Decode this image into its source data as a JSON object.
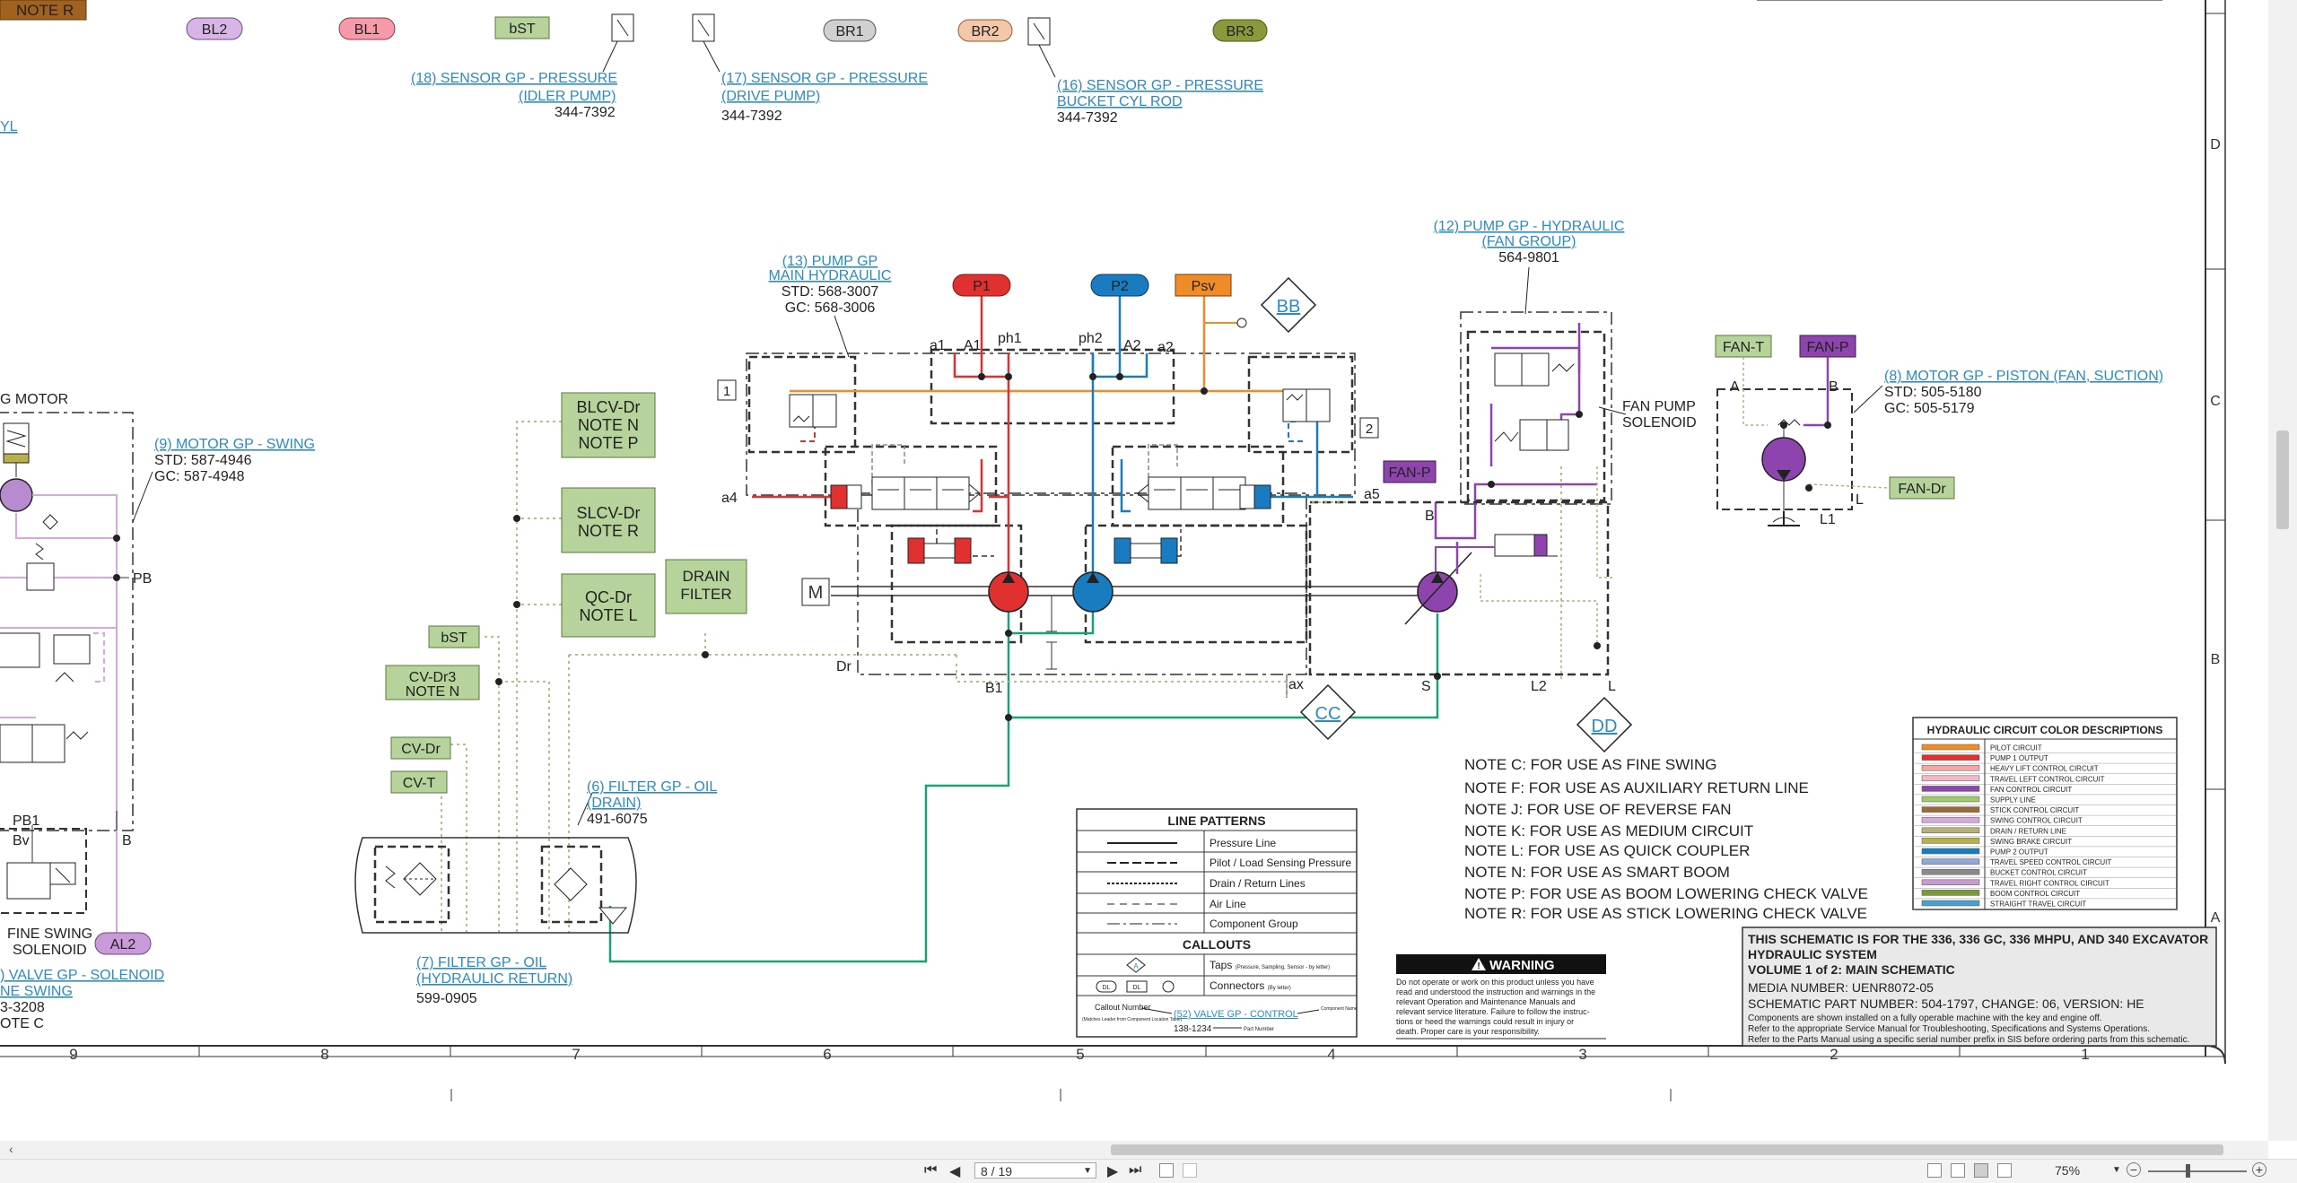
{
  "top_badges": {
    "bl2": "BL2",
    "bl1": "BL1",
    "bst": "bST",
    "br1": "BR1",
    "br2": "BR2",
    "br3": "BR3",
    "note_r": "NOTE R"
  },
  "callouts": {
    "c18_title": "(18) SENSOR GP - PRESSURE",
    "c18_sub": "(IDLER PUMP)",
    "c18_part": "344-7392",
    "c17_title": "(17) SENSOR GP - PRESSURE",
    "c17_sub": "(DRIVE PUMP)",
    "c17_part": "344-7392",
    "c16_title": "(16) SENSOR GP - PRESSURE",
    "c16_sub": "BUCKET CYL ROD",
    "c16_part": "344-7392",
    "yl": "YL",
    "c13_title": "(13) PUMP GP",
    "c13_sub": "MAIN HYDRAULIC",
    "c13_std": "STD: 568-3007",
    "c13_gc": "GC: 568-3006",
    "c12_title": "(12) PUMP GP - HYDRAULIC",
    "c12_sub": "(FAN GROUP)",
    "c12_part": "564-9801",
    "c8_title": "(8) MOTOR GP - PISTON (FAN, SUCTION)",
    "c8_std": "STD: 505-5180",
    "c8_gc": "GC: 505-5179",
    "c9_title": "(9) MOTOR GP - SWING",
    "c9_std": "STD: 587-4946",
    "c9_gc": "GC: 587-4948",
    "c6_title": "(6) FILTER GP - OIL",
    "c6_sub": "(DRAIN)",
    "c6_part": "491-6075",
    "c7_title": "(7) FILTER GP - OIL",
    "c7_sub": "(HYDRAULIC RETURN)",
    "c7_part": "599-0905",
    "cvalve_title": ") VALVE GP - SOLENOID",
    "cvalve_sub": "NE SWING",
    "cvalve_part": "3-3208",
    "cvalve_note": "OTE C",
    "swing_motor": "G MOTOR",
    "fan_pump_sol_1": "FAN PUMP",
    "fan_pump_sol_2": "SOLENOID",
    "fine_swing_1": "FINE SWING",
    "fine_swing_2": "SOLENOID"
  },
  "labels": {
    "p1": "P1",
    "p2": "P2",
    "psv": "Psv",
    "bb": "BB",
    "cc": "CC",
    "dd": "DD",
    "fan_t": "FAN-T",
    "fan_p": "FAN-P",
    "fan_p2": "FAN-P",
    "fan_dr": "FAN-Dr",
    "al2": "AL2",
    "a1": "A1",
    "a2": "A2",
    "a1l": "a1",
    "a2l": "a2",
    "ph1": "ph1",
    "ph2": "ph2",
    "a4": "a4",
    "a5": "a5",
    "dr": "Dr",
    "b1": "B1",
    "ax": "ax",
    "s": "S",
    "l2": "L2",
    "l": "L",
    "b": "B",
    "a": "A",
    "l1": "L1",
    "pb": "PB",
    "pb1": "PB1",
    "bv": "Bv",
    "one": "1",
    "two": "2",
    "m": "M"
  },
  "green_boxes": {
    "blcv": [
      "BLCV-Dr",
      "NOTE N",
      "NOTE P"
    ],
    "slcv": [
      "SLCV-Dr",
      "NOTE R"
    ],
    "qc": [
      "QC-Dr",
      "NOTE L"
    ],
    "drain": [
      "DRAIN",
      "FILTER"
    ],
    "bst": "bST",
    "cvdr3": [
      "CV-Dr3",
      "NOTE N"
    ],
    "cvdr": "CV-Dr",
    "cvt": "CV-T"
  },
  "notes": [
    "NOTE C: FOR USE AS FINE SWING",
    "NOTE F: FOR USE AS AUXILIARY RETURN LINE",
    "NOTE J: FOR USE OF REVERSE FAN",
    "NOTE K: FOR USE AS MEDIUM CIRCUIT",
    "NOTE L: FOR USE AS QUICK COUPLER",
    "NOTE N: FOR USE AS SMART BOOM",
    "NOTE P: FOR USE AS BOOM LOWERING CHECK VALVE",
    "NOTE R: FOR USE AS STICK LOWERING CHECK VALVE"
  ],
  "legend_lines": {
    "title": "LINE PATTERNS",
    "rows": [
      "Pressure Line",
      "Pilot / Load Sensing Pressure",
      "Drain / Return Lines",
      "Air Line",
      "Component Group"
    ],
    "callouts_title": "CALLOUTS",
    "taps": "Taps",
    "taps_small": "(Pressure, Sampling, Sensor - by letter)",
    "connectors": "Connectors",
    "connectors_small": "(By letter)",
    "callout_number": "Callout Number",
    "callout_small": "(Matches Leader from Component Location Table)",
    "callout_example": "(52) VALVE GP - CONTROL",
    "component_name": "Component Name",
    "part_example": "138-1234",
    "part_number": "Part Number",
    "tap_letter": "A",
    "dl": "DL"
  },
  "color_table": {
    "title": "HYDRAULIC CIRCUIT COLOR DESCRIPTIONS",
    "rows": [
      {
        "label": "PILOT CIRCUIT",
        "color": "#f08c28"
      },
      {
        "label": "PUMP 1 OUTPUT",
        "color": "#e03030"
      },
      {
        "label": "HEAVY LIFT CONTROL CIRCUIT",
        "color": "#f4a6a6"
      },
      {
        "label": "TRAVEL LEFT CONTROL CIRCUIT",
        "color": "#f5b7c8"
      },
      {
        "label": "FAN CONTROL CIRCUIT",
        "color": "#8e44ad"
      },
      {
        "label": "SUPPLY LINE",
        "color": "#9fc96a"
      },
      {
        "label": "STICK CONTROL CIRCUIT",
        "color": "#9a6a3a"
      },
      {
        "label": "SWING CONTROL CIRCUIT",
        "color": "#d9a6e0"
      },
      {
        "label": "DRAIN / RETURN LINE",
        "color": "#b8b07a"
      },
      {
        "label": "SWING BRAKE CIRCUIT",
        "color": "#b9b04b"
      },
      {
        "label": "PUMP 2 OUTPUT",
        "color": "#1a7cc0"
      },
      {
        "label": "TRAVEL SPEED CONTROL CIRCUIT",
        "color": "#8fa8d8"
      },
      {
        "label": "BUCKET CONTROL CIRCUIT",
        "color": "#8a8a8a"
      },
      {
        "label": "TRAVEL RIGHT CONTROL CIRCUIT",
        "color": "#c79ad0"
      },
      {
        "label": "BOOM CONTROL CIRCUIT",
        "color": "#7a9a3a"
      },
      {
        "label": "STRAIGHT TRAVEL CIRCUIT",
        "color": "#4aa0c8"
      }
    ]
  },
  "warning": {
    "title": "WARNING",
    "lines": [
      "Do not operate or work on this product unless you have",
      "read and understood the instruction and warnings in the",
      "relevant Operation and Maintenance Manuals and",
      "relevant service literature. Failure to follow the instruc-",
      "tions or heed the warnings could result in injury or",
      "death. Proper care is your responsibility."
    ]
  },
  "title_block": {
    "line1": "THIS SCHEMATIC IS FOR THE 336, 336 GC, 336 MHPU, AND 340 EXCAVATOR",
    "line2": "HYDRAULIC SYSTEM",
    "line3": "VOLUME 1 of 2: MAIN SCHEMATIC",
    "media": "MEDIA NUMBER: UENR8072-05",
    "part": "SCHEMATIC PART NUMBER: 504-1797, CHANGE: 06, VERSION: HE",
    "f1": "Components are shown installed on a fully operable machine with the key and engine off.",
    "f2": "Refer to the appropriate Service Manual for Troubleshooting, Specifications and Systems Operations.",
    "f3": "Refer to the Parts Manual using a specific serial number prefix in SIS before ordering parts from this schematic."
  },
  "grid": {
    "cols": [
      "9",
      "8",
      "7",
      "6",
      "5",
      "4",
      "3",
      "2",
      "1"
    ],
    "rows": [
      "D",
      "C",
      "B",
      "A"
    ]
  },
  "toolbar": {
    "page": "8 / 19",
    "zoom": "75%"
  },
  "colors": {
    "pump1": "#e03030",
    "pump2": "#1a7cc0",
    "pilot": "#f08c28",
    "fan": "#8e44ad",
    "supply_green": "#a9c98a",
    "return_green": "#1aa07a",
    "swing": "#d9a6e0"
  }
}
